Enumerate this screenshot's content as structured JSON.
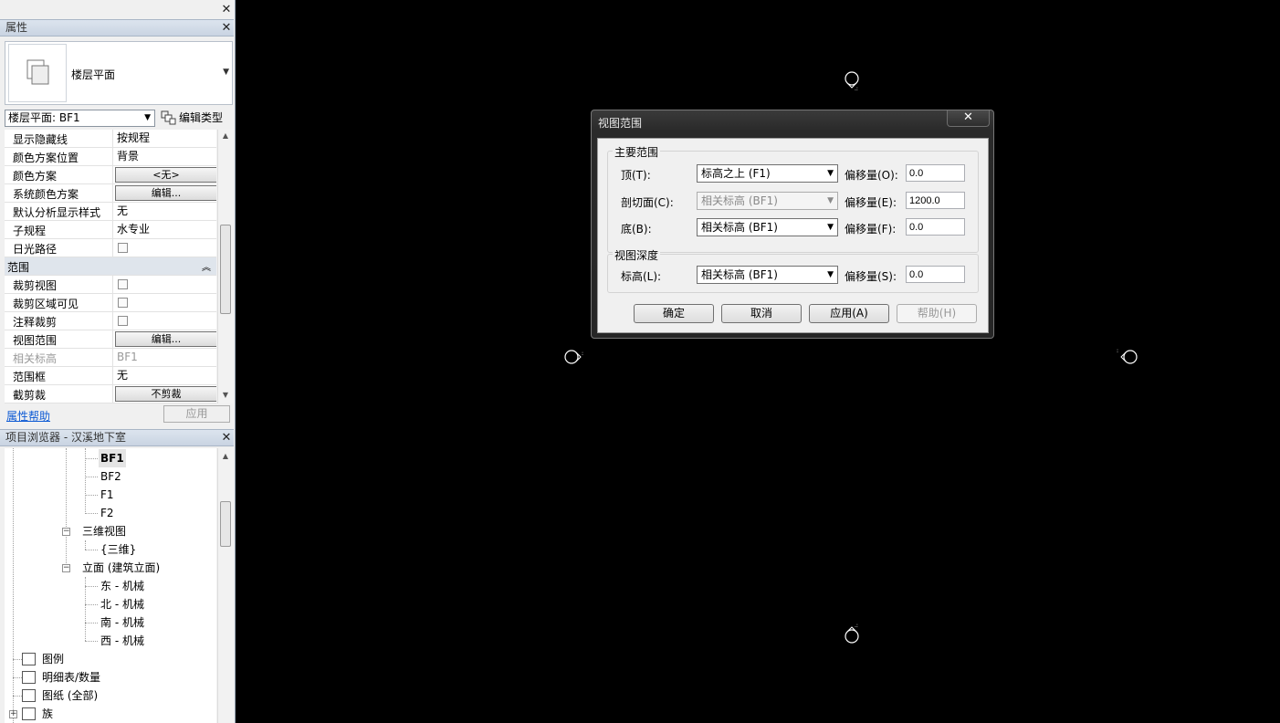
{
  "properties": {
    "title": "属性",
    "type_name": "楼层平面",
    "view_selector": "楼层平面: BF1",
    "edit_type_label": "编辑类型",
    "rows": [
      {
        "name": "显示隐藏线",
        "value": "按规程"
      },
      {
        "name": "颜色方案位置",
        "value": "背景"
      },
      {
        "name": "颜色方案",
        "button": "<无>"
      },
      {
        "name": "系统颜色方案",
        "button": "编辑..."
      },
      {
        "name": "默认分析显示样式",
        "value": "无"
      },
      {
        "name": "子规程",
        "value": "水专业"
      },
      {
        "name": "日光路径",
        "checkbox": false
      }
    ],
    "group_label": "范围",
    "range_rows": [
      {
        "name": "裁剪视图",
        "checkbox": false
      },
      {
        "name": "裁剪区域可见",
        "checkbox": false
      },
      {
        "name": "注释裁剪",
        "checkbox": false
      },
      {
        "name": "视图范围",
        "button": "编辑..."
      },
      {
        "name": "相关标高",
        "value": "BF1",
        "disabled": true
      },
      {
        "name": "范围框",
        "value": "无"
      },
      {
        "name": "截剪裁",
        "button": "不剪裁"
      }
    ],
    "help_link": "属性帮助",
    "apply_label": "应用"
  },
  "browser": {
    "title": "项目浏览器 - 汉溪地下室",
    "nodes": {
      "bf1": "BF1",
      "bf2": "BF2",
      "f1": "F1",
      "f2": "F2",
      "views3d": "三维视图",
      "view3d": "{三维}",
      "elevations": "立面 (建筑立面)",
      "east": "东 - 机械",
      "north": "北 - 机械",
      "south": "南 - 机械",
      "west": "西 - 机械",
      "legends": "图例",
      "schedules": "明细表/数量",
      "sheets": "图纸 (全部)",
      "families": "族"
    }
  },
  "dialog": {
    "title": "视图范围",
    "close": "✕",
    "primary_range": "主要范围",
    "top_label": "顶(T):",
    "top_value": "标高之上 (F1)",
    "top_offset_label": "偏移量(O):",
    "top_offset": "0.0",
    "cut_label": "剖切面(C):",
    "cut_value": "相关标高 (BF1)",
    "cut_offset_label": "偏移量(E):",
    "cut_offset": "1200.0",
    "bottom_label": "底(B):",
    "bottom_value": "相关标高 (BF1)",
    "bottom_offset_label": "偏移量(F):",
    "bottom_offset": "0.0",
    "view_depth": "视图深度",
    "level_label": "标高(L):",
    "level_value": "相关标高 (BF1)",
    "level_offset_label": "偏移量(S):",
    "level_offset": "0.0",
    "ok": "确定",
    "cancel": "取消",
    "apply": "应用(A)",
    "help": "帮助(H)"
  },
  "icons": {
    "close": "close-icon",
    "dropdown": "chevron-down-icon",
    "type_thumbnail": "floor-plan-icon",
    "edit_type": "edit-type-icon",
    "collapse_group": "double-chevron-up-icon"
  }
}
